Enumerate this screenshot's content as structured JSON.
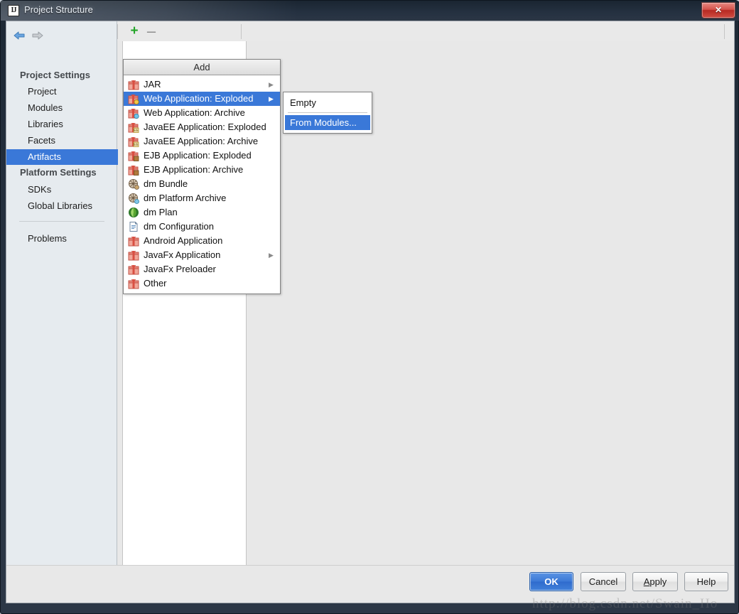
{
  "window": {
    "title": "Project Structure",
    "app_icon": "IJ",
    "close_label": "✕"
  },
  "sidebar": {
    "back_icon": "arrow-left-icon",
    "forward_icon": "arrow-right-icon",
    "groups": [
      {
        "label": "Project Settings",
        "items": [
          {
            "label": "Project",
            "selected": false
          },
          {
            "label": "Modules",
            "selected": false
          },
          {
            "label": "Libraries",
            "selected": false
          },
          {
            "label": "Facets",
            "selected": false
          },
          {
            "label": "Artifacts",
            "selected": true
          }
        ]
      },
      {
        "label": "Platform Settings",
        "items": [
          {
            "label": "SDKs",
            "selected": false
          },
          {
            "label": "Global Libraries",
            "selected": false
          }
        ]
      }
    ],
    "problems_label": "Problems"
  },
  "toolbar": {
    "add_label": "+",
    "remove_label": "–"
  },
  "add_menu": {
    "header": "Add",
    "items": [
      {
        "label": "JAR",
        "icon": "package-icon",
        "has_submenu": true,
        "selected": false
      },
      {
        "label": "Web Application: Exploded",
        "icon": "package-web-icon",
        "has_submenu": true,
        "selected": true
      },
      {
        "label": "Web Application: Archive",
        "icon": "package-web-icon",
        "has_submenu": false,
        "selected": false
      },
      {
        "label": "JavaEE Application: Exploded",
        "icon": "package-javaee-icon",
        "has_submenu": false,
        "selected": false
      },
      {
        "label": "JavaEE Application: Archive",
        "icon": "package-javaee-icon",
        "has_submenu": false,
        "selected": false
      },
      {
        "label": "EJB Application: Exploded",
        "icon": "package-ejb-icon",
        "has_submenu": false,
        "selected": false
      },
      {
        "label": "EJB Application: Archive",
        "icon": "package-ejb-icon",
        "has_submenu": false,
        "selected": false
      },
      {
        "label": "dm Bundle",
        "icon": "dm-bundle-icon",
        "has_submenu": false,
        "selected": false
      },
      {
        "label": "dm Platform Archive",
        "icon": "dm-platform-icon",
        "has_submenu": false,
        "selected": false
      },
      {
        "label": "dm Plan",
        "icon": "dm-plan-icon",
        "has_submenu": false,
        "selected": false
      },
      {
        "label": "dm Configuration",
        "icon": "document-icon",
        "has_submenu": false,
        "selected": false
      },
      {
        "label": "Android Application",
        "icon": "package-icon",
        "has_submenu": false,
        "selected": false
      },
      {
        "label": "JavaFx Application",
        "icon": "package-icon",
        "has_submenu": true,
        "selected": false
      },
      {
        "label": "JavaFx Preloader",
        "icon": "package-icon",
        "has_submenu": false,
        "selected": false
      },
      {
        "label": "Other",
        "icon": "package-icon",
        "has_submenu": false,
        "selected": false
      }
    ]
  },
  "submenu": {
    "items": [
      {
        "label": "Empty",
        "selected": false
      },
      {
        "label": "From Modules...",
        "selected": true
      }
    ]
  },
  "buttons": {
    "ok": "OK",
    "cancel": "Cancel",
    "apply_prefix": "A",
    "apply_rest": "pply",
    "help": "Help"
  },
  "watermark": "http://blog.csdn.net/Swain_Ho",
  "colors": {
    "selection_blue": "#3a78d8",
    "primary_button": "#3b78d6",
    "add_green": "#25a52a",
    "titlebar": "#243040",
    "close_red": "#d4514a"
  }
}
